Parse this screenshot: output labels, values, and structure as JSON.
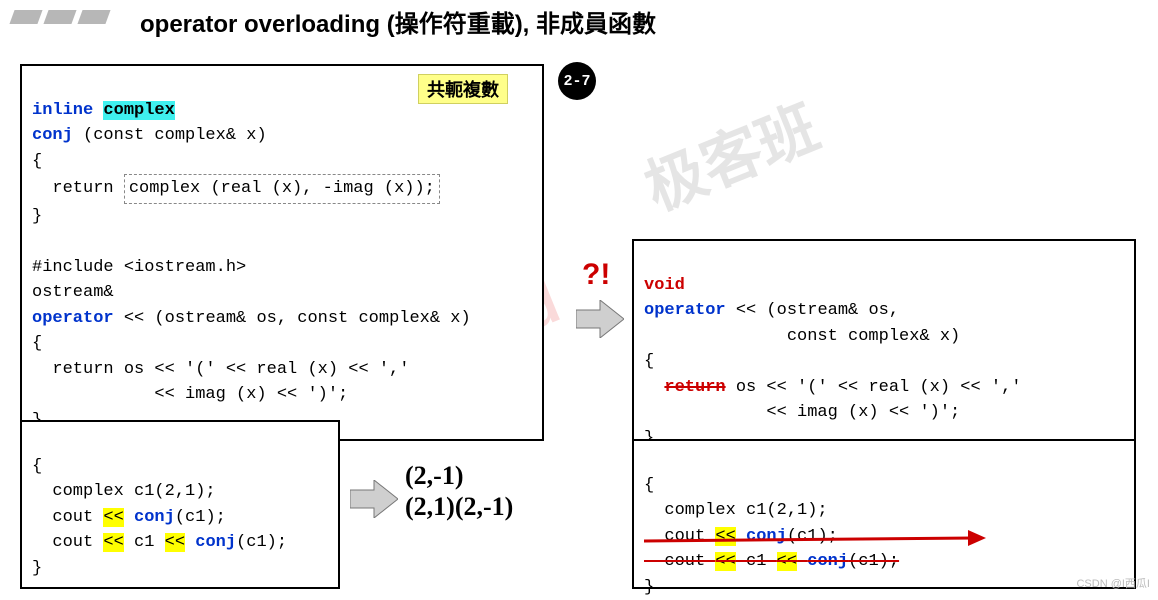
{
  "title": "operator overloading (操作符重載), 非成員函數",
  "badge": "2-7",
  "conjugate_label": "共軛複數",
  "qmark": "?!",
  "main_code": {
    "l1a": "inline ",
    "l1b": "complex",
    "l2a": "conj",
    "l2b": " (const complex& x)",
    "l3": "{",
    "l4a": "  return ",
    "l4b": "complex (real (x), -imag (x));",
    "l5": "}",
    "l6": "",
    "l7": "#include <iostream.h>",
    "l8": "ostream&",
    "l9a": "operator",
    "l9b": " << (ostream& os, const complex& x)",
    "l10": "{",
    "l11": "  return os << '(' << real (x) << ','",
    "l12": "            << imag (x) << ')';",
    "l13": "}"
  },
  "usage_code": {
    "l1": "{",
    "l2": "  complex c1(2,1);",
    "l3a": "  cout ",
    "l3b": "<<",
    "l3c": " ",
    "l3d": "conj",
    "l3e": "(c1);",
    "l4a": "  cout ",
    "l4b": "<<",
    "l4c": " c1 ",
    "l4d": "<<",
    "l4e": " ",
    "l4f": "conj",
    "l4g": "(c1);",
    "l5": "}"
  },
  "void_code": {
    "l1": "void",
    "l2a": "operator",
    "l2b": " << (ostream& os,",
    "l3": "              const complex& x)",
    "l4": "{",
    "l5a": "  ",
    "l5b": "return",
    "l5c": " os << '(' << real (x) << ','",
    "l6": "            << imag (x) << ')';",
    "l7": "}"
  },
  "void_usage": {
    "l1": "{",
    "l2": "  complex c1(2,1);",
    "l3a": "  cout ",
    "l3b": "<<",
    "l3c": " ",
    "l3d": "conj",
    "l3e": "(c1);",
    "l4a": "  cout ",
    "l4b": "<<",
    "l4c": " c1 ",
    "l4d": "<<",
    "l4e": " ",
    "l4f": "conj",
    "l4g": "(c1);",
    "l5": "}"
  },
  "output": {
    "l1": "(2,-1)",
    "l2": "(2,1)(2,-1)"
  },
  "watermark_en": "GeekBand",
  "watermark_cn": "极客班",
  "corner": "CSDN @I西瓜I"
}
